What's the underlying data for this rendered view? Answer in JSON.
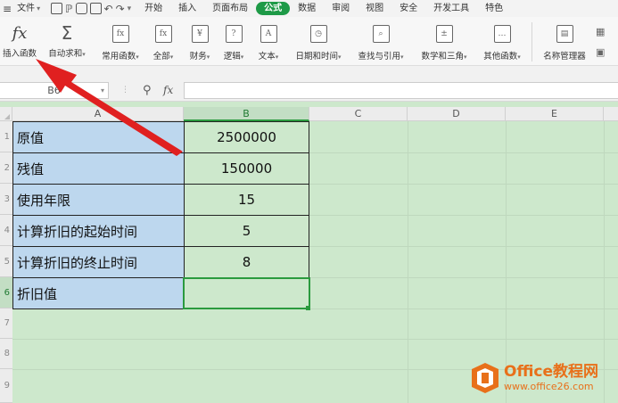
{
  "menubar": {
    "file_label": "文件",
    "tabs": [
      "开始",
      "插入",
      "页面布局",
      "公式",
      "数据",
      "审阅",
      "视图",
      "安全",
      "开发工具",
      "特色"
    ],
    "active_tab": "公式"
  },
  "ribbon": {
    "buttons": [
      {
        "label": "插入函数",
        "icon": "fx-icon",
        "glyph": "fx"
      },
      {
        "label": "自动求和",
        "icon": "sigma-icon",
        "glyph": "Σ"
      },
      {
        "label": "常用函数",
        "icon": "common-functions-icon",
        "glyph": "fx"
      },
      {
        "label": "全部",
        "icon": "all-functions-icon",
        "glyph": "fx"
      },
      {
        "label": "财务",
        "icon": "finance-icon",
        "glyph": "¥"
      },
      {
        "label": "逻辑",
        "icon": "logic-icon",
        "glyph": "?"
      },
      {
        "label": "文本",
        "icon": "text-icon",
        "glyph": "A"
      },
      {
        "label": "日期和时间",
        "icon": "datetime-icon",
        "glyph": "◷"
      },
      {
        "label": "查找与引用",
        "icon": "lookup-icon",
        "glyph": "⌕"
      },
      {
        "label": "数学和三角",
        "icon": "math-icon",
        "glyph": "±"
      },
      {
        "label": "其他函数",
        "icon": "more-functions-icon",
        "glyph": "…"
      },
      {
        "label": "名称管理器",
        "icon": "name-manager-icon",
        "glyph": "▤"
      }
    ]
  },
  "formula_bar": {
    "cell_ref": "B6",
    "fx": "fx",
    "formula": ""
  },
  "columns": [
    "A",
    "B",
    "C",
    "D",
    "E"
  ],
  "rows": [
    "1",
    "2",
    "3",
    "4",
    "5",
    "6",
    "7",
    "8",
    "9"
  ],
  "table": [
    {
      "label": "原值",
      "value": "2500000"
    },
    {
      "label": "残值",
      "value": "150000"
    },
    {
      "label": "使用年限",
      "value": "15"
    },
    {
      "label": "计算折旧的起始时间",
      "value": "5"
    },
    {
      "label": "计算折旧的终止时间",
      "value": "8"
    },
    {
      "label": "折旧值",
      "value": ""
    }
  ],
  "colors": {
    "accent": "#1e9a47",
    "grid_bg": "#cde8cc",
    "label_cell_bg": "#bdd7ee",
    "arrow": "#e02020",
    "watermark": "#e8701a"
  },
  "watermark": {
    "title": "Office教程网",
    "url": "www.office26.com"
  }
}
